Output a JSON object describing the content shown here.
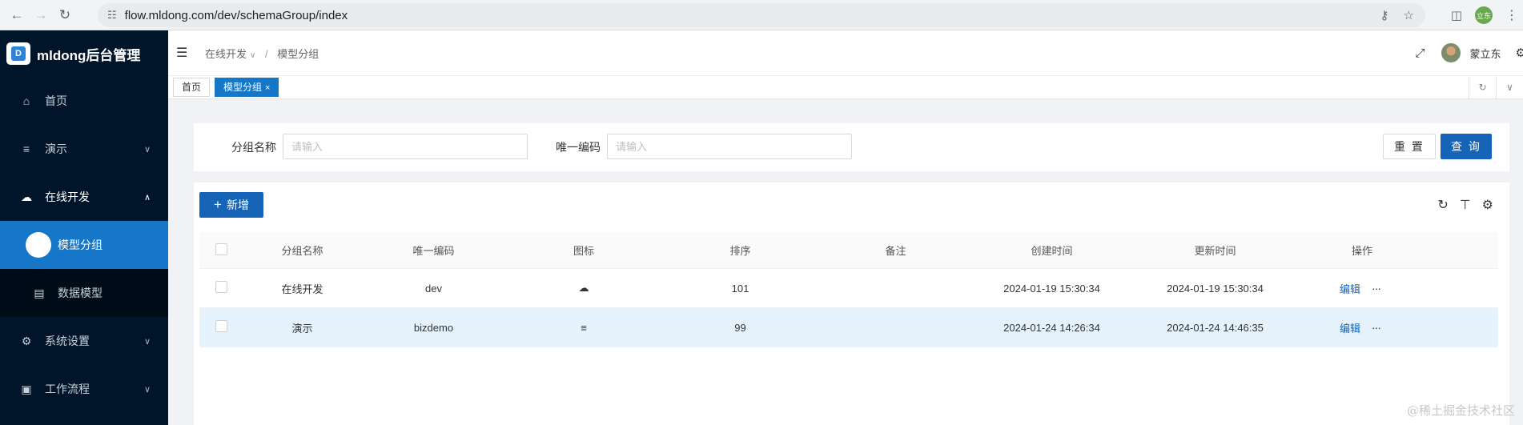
{
  "browser": {
    "url": "flow.mldong.com/dev/schemaGroup/index",
    "profile_initials": "立东"
  },
  "app": {
    "title": "mldong后台管理",
    "logo_letter": "D"
  },
  "sidebar": {
    "items": [
      {
        "label": "首页",
        "icon": "home-icon"
      },
      {
        "label": "演示",
        "icon": "list-icon"
      },
      {
        "label": "在线开发",
        "icon": "cloud-icon"
      },
      {
        "label": "模型分组",
        "icon": "circle-icon"
      },
      {
        "label": "数据模型",
        "icon": "table-icon"
      },
      {
        "label": "系统设置",
        "icon": "gear-icon"
      },
      {
        "label": "工作流程",
        "icon": "laptop-icon"
      }
    ]
  },
  "header": {
    "breadcrumb": [
      "在线开发",
      "模型分组"
    ],
    "user_name": "蒙立东"
  },
  "tabs": [
    {
      "label": "首页",
      "active": false
    },
    {
      "label": "模型分组",
      "active": true,
      "close": "×"
    }
  ],
  "search": {
    "group_name_label": "分组名称",
    "group_name_placeholder": "请输入",
    "code_label": "唯一编码",
    "code_placeholder": "请输入",
    "reset_label": "重 置",
    "query_label": "查 询"
  },
  "table": {
    "add_label": "新增",
    "columns": [
      "分组名称",
      "唯一编码",
      "图标",
      "排序",
      "备注",
      "创建时间",
      "更新时间",
      "操作"
    ],
    "rows": [
      {
        "name": "在线开发",
        "code": "dev",
        "icon": "cloud-icon",
        "sort": "101",
        "remark": "",
        "created": "2024-01-19 15:30:34",
        "updated": "2024-01-19 15:30:34",
        "edit": "编辑",
        "more": "···"
      },
      {
        "name": "演示",
        "code": "bizdemo",
        "icon": "list-icon",
        "sort": "99",
        "remark": "",
        "created": "2024-01-24 14:26:34",
        "updated": "2024-01-24 14:46:35",
        "edit": "编辑",
        "more": "···"
      }
    ]
  },
  "watermark": "@稀土掘金技术社区",
  "colors": {
    "sidebar_bg": "#001529",
    "primary": "#1564b7",
    "active_menu": "#1677c9",
    "highlight_row": "#e6f2fb"
  }
}
